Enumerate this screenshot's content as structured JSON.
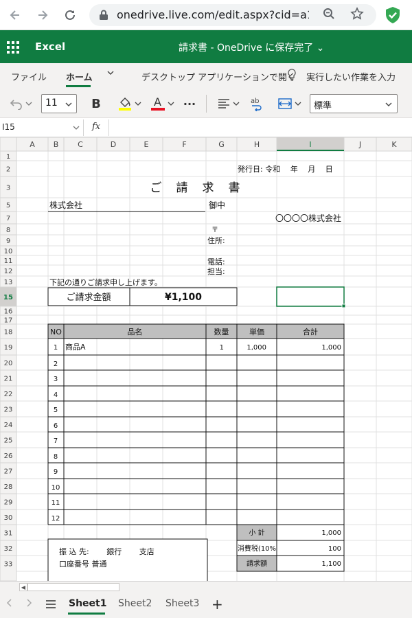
{
  "browser": {
    "url": "onedrive.live.com/edit.aspx?cid=a1...",
    "icons": [
      "back-arrow-icon",
      "forward-arrow-icon",
      "reload-icon",
      "lock-icon",
      "zoom-icon",
      "star-icon",
      "shield-check-icon"
    ]
  },
  "app": {
    "name": "Excel",
    "doc_title": "請求書 - OneDrive に保存完了 ⌄"
  },
  "ribbon": {
    "tabs": [
      "ファイル",
      "ホーム",
      "デスクトップ アプリケーションで開く",
      "実行したい作業を入力"
    ],
    "active_tab": "ホーム",
    "font_size": "11",
    "number_format": "標準",
    "bold_label": "B",
    "font_color_label": "A",
    "more_label": "···"
  },
  "formula_bar": {
    "cell_ref": "I15",
    "fx_label": "fx",
    "formula": ""
  },
  "grid": {
    "columns": [
      "A",
      "B",
      "C",
      "D",
      "E",
      "F",
      "G",
      "H",
      "I",
      "J",
      "K"
    ],
    "rows": [
      "1",
      "2",
      "3",
      "5",
      "7",
      "8",
      "9",
      "10",
      "11",
      "12",
      "13",
      "15",
      "16",
      "17",
      "18",
      "19",
      "20",
      "21",
      "22",
      "23",
      "24",
      "25",
      "26",
      "27",
      "28",
      "29",
      "30",
      "31",
      "32",
      "33"
    ],
    "selected_cell": "I15"
  },
  "invoice": {
    "issue_date": "発行日: 令和　 年　 月　 日",
    "title": "ご　請　求　書",
    "client": "株式会社",
    "honorific": "御中",
    "issuer": "〇〇〇〇株式会社",
    "postal_mark": "〒",
    "address_label": "住所:",
    "phone_label": "電話:",
    "contact_label": "担当:",
    "intro": "下記の通りご請求申し上げます。",
    "amount_label": "ご請求金額",
    "amount_value": "¥1,100",
    "table_headers": [
      "NO",
      "品名",
      "数量",
      "単価",
      "合計"
    ],
    "items": [
      {
        "no": "1",
        "name": "商品A",
        "qty": "1",
        "price": "1,000",
        "total": "1,000"
      },
      {
        "no": "2"
      },
      {
        "no": "3"
      },
      {
        "no": "4"
      },
      {
        "no": "5"
      },
      {
        "no": "6"
      },
      {
        "no": "7"
      },
      {
        "no": "8"
      },
      {
        "no": "9"
      },
      {
        "no": "10"
      },
      {
        "no": "11"
      },
      {
        "no": "12"
      }
    ],
    "subtotal_label": "小 計",
    "subtotal_value": "1,000",
    "tax_label": "消費税(10%",
    "tax_value": "100",
    "billed_label": "請求額",
    "billed_value": "1,100",
    "bank_line": "振 込 先:　　 銀行　　 支店",
    "bank_line2": "口座番号 普通"
  },
  "sheets": [
    "Sheet1",
    "Sheet2",
    "Sheet3"
  ],
  "active_sheet": "Sheet1",
  "colors": {
    "excel_green": "#107c41",
    "header_gray": "#bfbfbf"
  }
}
